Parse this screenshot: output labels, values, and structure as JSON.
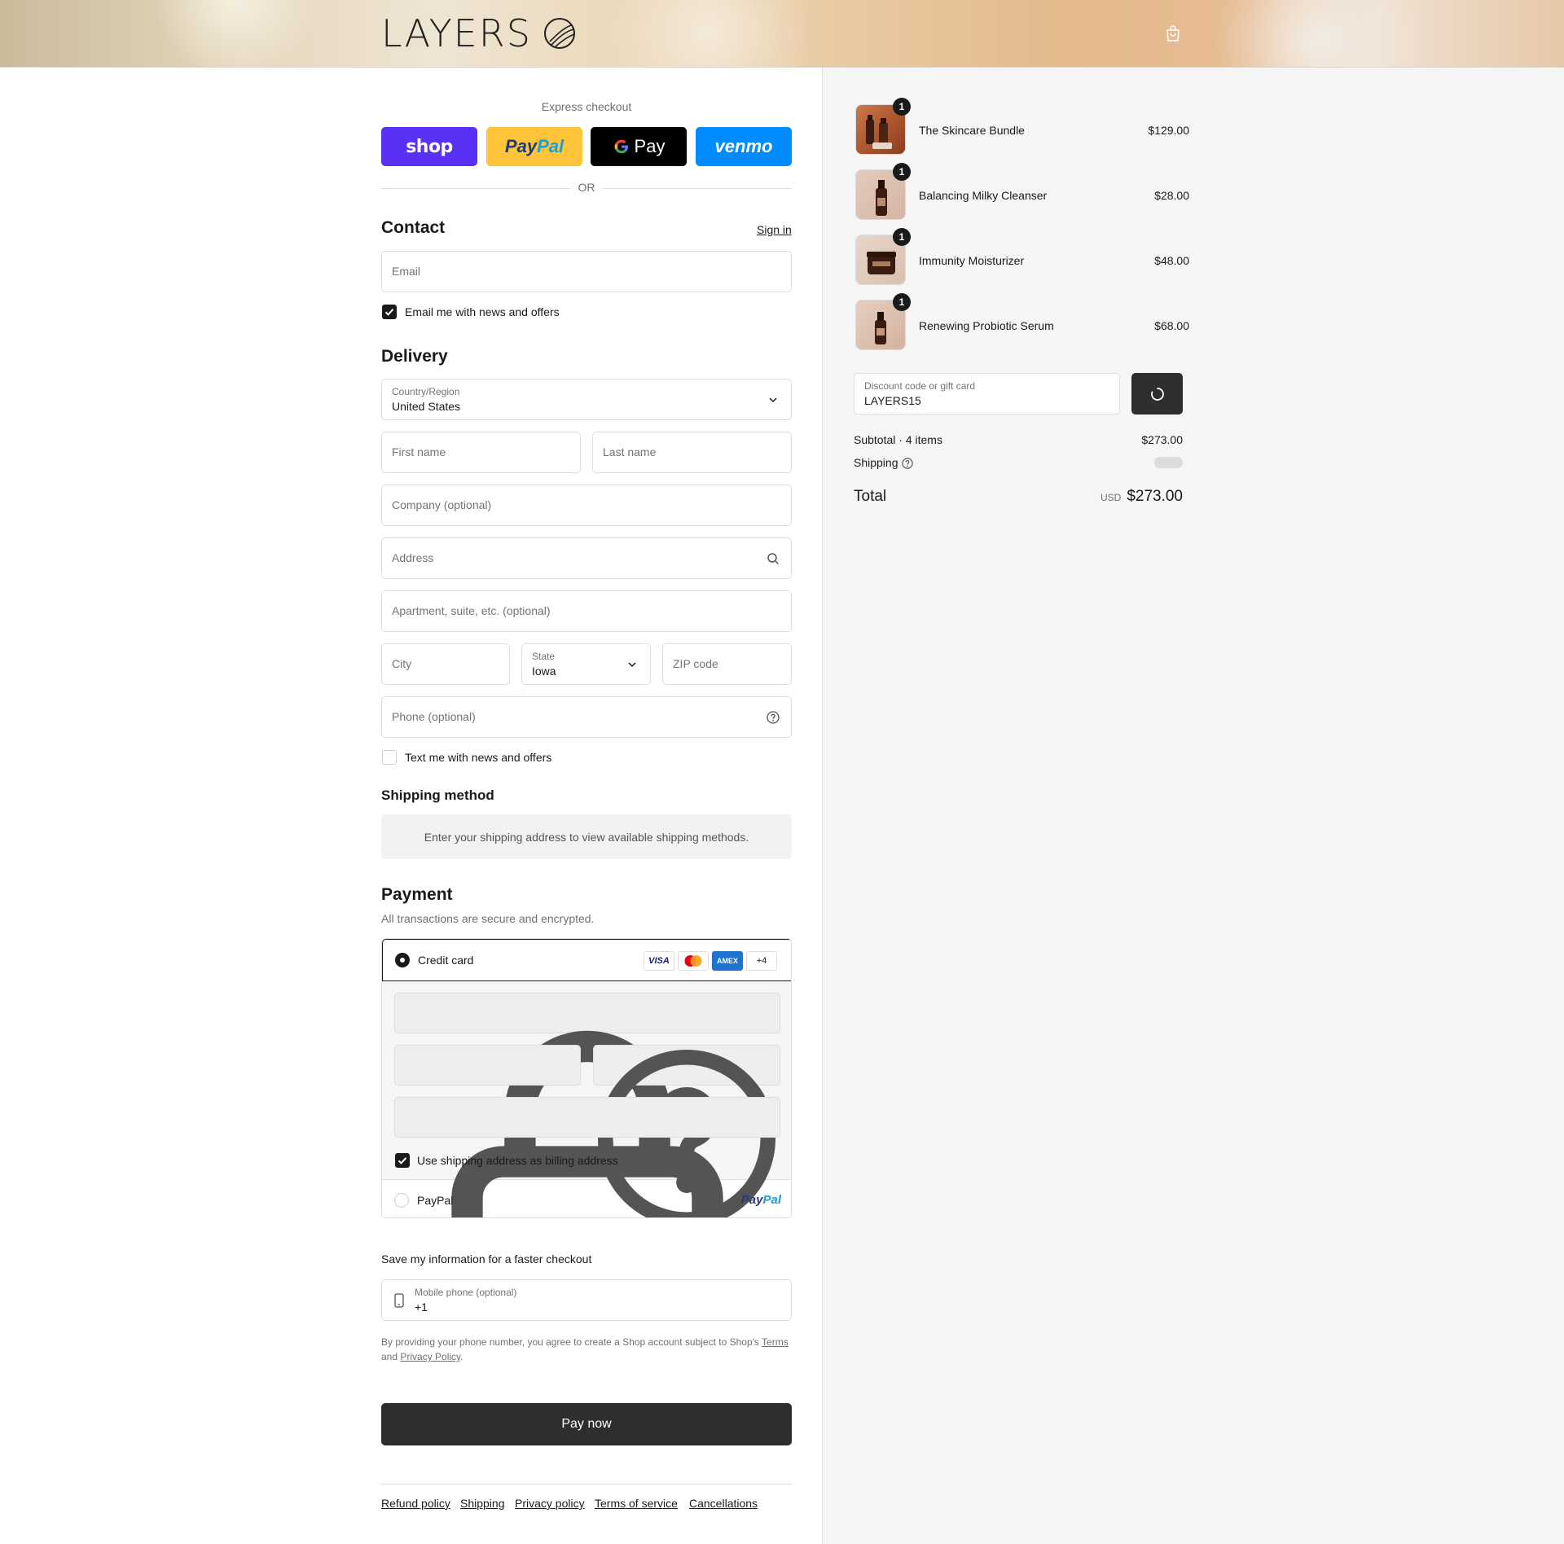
{
  "header": {
    "brand": "LAYERS"
  },
  "express": {
    "title": "Express checkout",
    "shop_label": "shop",
    "paypal_label_a": "Pay",
    "paypal_label_b": "Pal",
    "gpay_label": "Pay",
    "venmo_label": "venmo",
    "or_label": "OR"
  },
  "contact": {
    "title": "Contact",
    "sign_in": "Sign in",
    "email_placeholder": "Email",
    "news_label": "Email me with news and offers",
    "news_checked": true
  },
  "delivery": {
    "title": "Delivery",
    "country_label": "Country/Region",
    "country_value": "United States",
    "first_name": "First name",
    "last_name": "Last name",
    "company": "Company (optional)",
    "address": "Address",
    "apartment": "Apartment, suite, etc. (optional)",
    "city": "City",
    "state_label": "State",
    "state_value": "Iowa",
    "zip": "ZIP code",
    "phone": "Phone (optional)",
    "text_label": "Text me with news and offers",
    "text_checked": false
  },
  "shipping_method": {
    "title": "Shipping method",
    "message": "Enter your shipping address to view available shipping methods."
  },
  "payment": {
    "title": "Payment",
    "subtitle": "All transactions are secure and encrypted.",
    "credit_card_label": "Credit card",
    "cards": [
      "VISA",
      "Mastercard",
      "AMEX",
      "+4"
    ],
    "billing_label": "Use shipping address as billing address",
    "paypal_label": "PayPal",
    "paypal_logo_a": "Pay",
    "paypal_logo_b": "Pal"
  },
  "save_info": {
    "title": "Save my information for a faster checkout",
    "mobile_label": "Mobile phone (optional)",
    "mobile_value": "+1",
    "disclaimer_a": "By providing your phone number, you agree to create a Shop account subject to Shop's ",
    "terms": "Terms",
    "disclaimer_b": "and ",
    "privacy": "Privacy Policy",
    "disclaimer_c": "."
  },
  "pay_now": "Pay now",
  "footer_links": [
    "Refund policy",
    "Shipping",
    "Privacy policy",
    "Terms of service",
    "Cancellations"
  ],
  "cart": {
    "items": [
      {
        "name": "The Skincare Bundle",
        "price": "$129.00",
        "qty": "1"
      },
      {
        "name": "Balancing Milky Cleanser",
        "price": "$28.00",
        "qty": "1"
      },
      {
        "name": "Immunity Moisturizer",
        "price": "$48.00",
        "qty": "1"
      },
      {
        "name": "Renewing Probiotic Serum",
        "price": "$68.00",
        "qty": "1"
      }
    ],
    "discount_label": "Discount code or gift card",
    "discount_value": "LAYERS15",
    "subtotal_label": "Subtotal · 4 items",
    "subtotal_value": "$273.00",
    "shipping_label": "Shipping",
    "total_label": "Total",
    "currency": "USD",
    "total_value": "$273.00"
  },
  "colors": {
    "shop": "#5a31f4",
    "paypal": "#ffc439",
    "venmo": "#008cff",
    "button_dark": "#2e2e2e"
  }
}
